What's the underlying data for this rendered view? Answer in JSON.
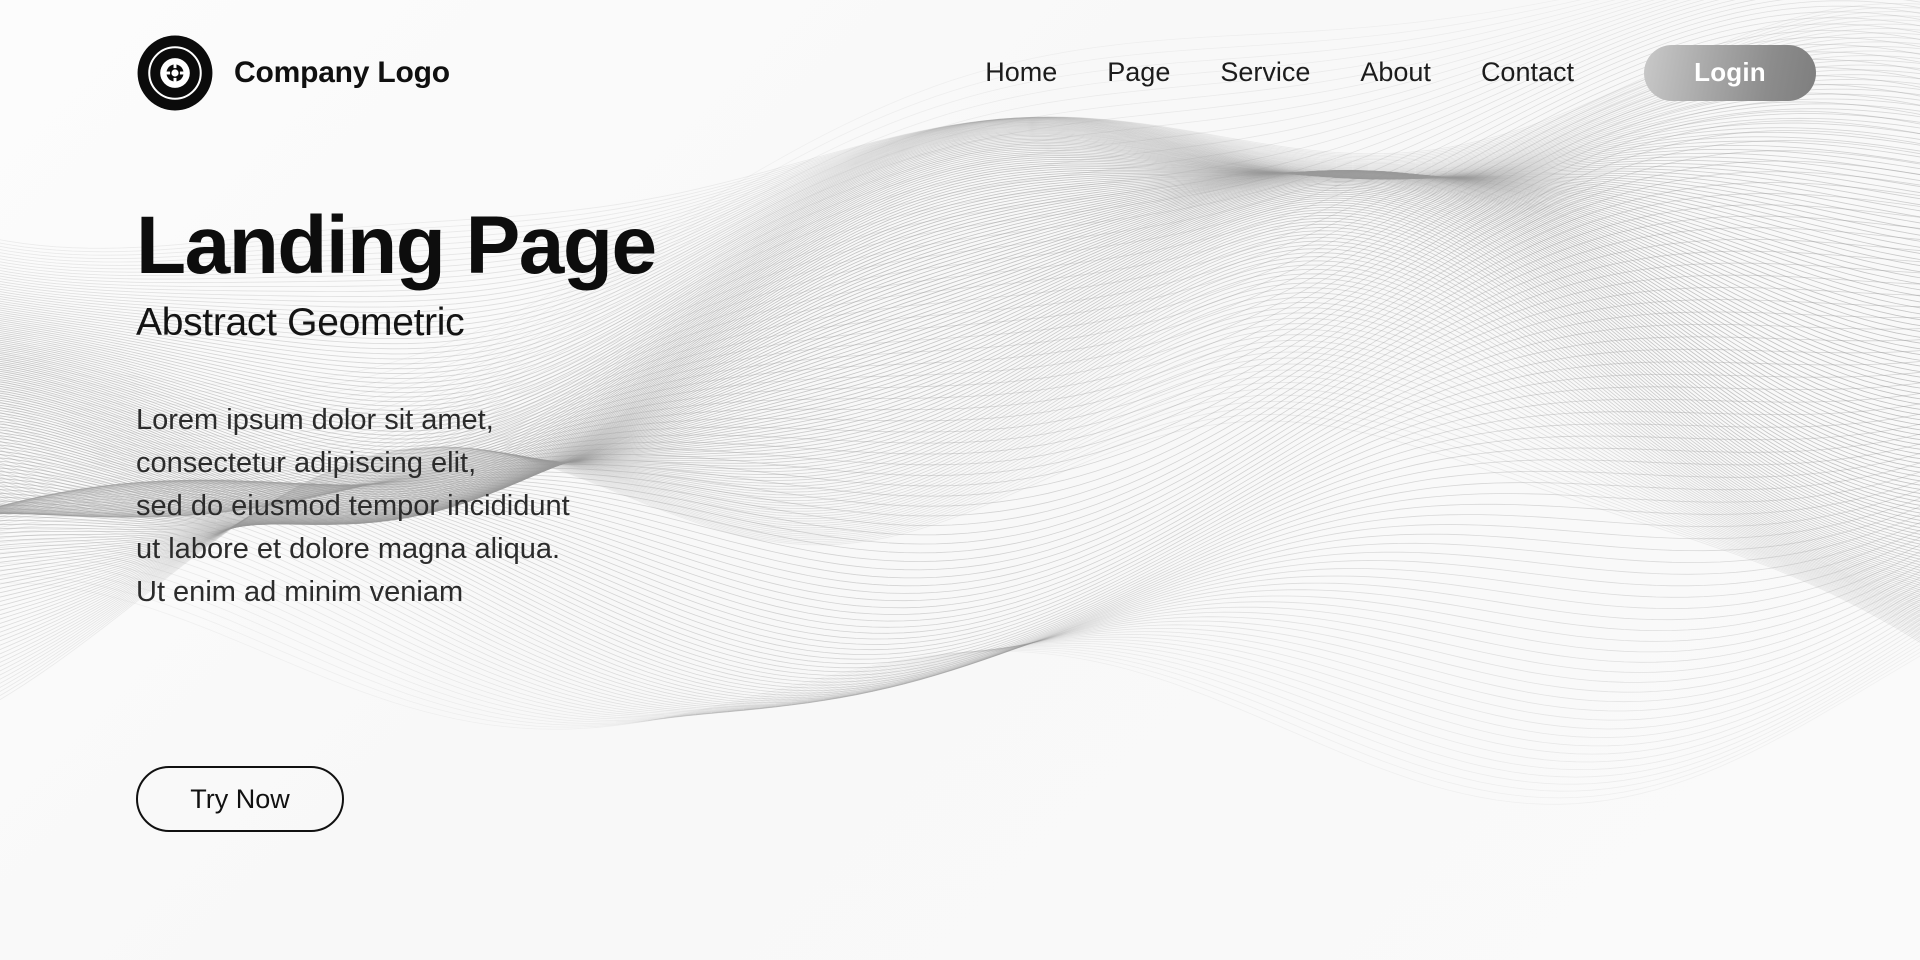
{
  "page": {
    "background_color": "#fbfbfb",
    "accent_dark": "#0d0d0d",
    "wave_line_color": "#9a9a9a"
  },
  "header": {
    "logo_icon": "concentric-circle-logo-icon",
    "brand_name": "Company Logo",
    "nav": [
      {
        "label": "Home"
      },
      {
        "label": "Page"
      },
      {
        "label": "Service"
      },
      {
        "label": "About"
      },
      {
        "label": "Contact"
      }
    ],
    "login_label": "Login",
    "login_gradient_from": "#c9c9c9",
    "login_gradient_to": "#7e7e7e"
  },
  "hero": {
    "title": "Landing Page",
    "subtitle": "Abstract Geometric",
    "paragraph": "Lorem ipsum dolor sit amet,\nconsectetur adipiscing elit,\nsed do eiusmod tempor incididunt\nut labore et dolore magna aliqua.\nUt enim ad minim veniam",
    "cta_label": "Try Now"
  }
}
